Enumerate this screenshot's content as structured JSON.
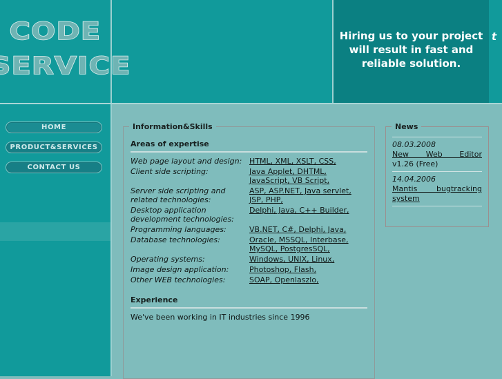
{
  "header": {
    "logo_line1": "CODE",
    "logo_line2": "SERVICE",
    "slogan": "Hiring us to your project will result in fast and reliable solution.",
    "slogan_next_partial": "t"
  },
  "sidebar": {
    "items": [
      {
        "label": "HOME"
      },
      {
        "label": "PRODUCT&SERVICES"
      },
      {
        "label": "CONTACT US"
      }
    ]
  },
  "info_panel": {
    "legend": "Information&Skills",
    "areas_title": "Areas of expertise",
    "skills": [
      {
        "label": "Web page layout and design:",
        "value": "HTML, XML, XSLT, CSS,"
      },
      {
        "label": "Client side scripting:",
        "value": "Java Applet, DHTML, JavaScript, VB Script,"
      },
      {
        "label": "Server side scripting and related technologies:",
        "value": "ASP, ASP.NET, Java servlet, JSP, PHP,"
      },
      {
        "label": "Desktop application development technologies:",
        "value": "Delphi, Java, C++ Builder,"
      },
      {
        "label": "Programming languages:",
        "value": "VB.NET, C#, Delphi, Java,"
      },
      {
        "label": "Database technologies:",
        "value": "Oracle, MSSQL, Interbase, MySQL, PostgresSQL,"
      },
      {
        "label": "Operating systems:",
        "value": "Windows, UNIX, Linux,"
      },
      {
        "label": "Image design application:",
        "value": "Photoshop, Flash,"
      },
      {
        "label": "Other WEB technologies:",
        "value": "SOAP, Openlaszlo,"
      }
    ],
    "experience_title": "Experience",
    "experience_text": "We've been working in IT industries since 1996"
  },
  "news_panel": {
    "legend": "News",
    "entries": [
      {
        "date": "08.03.2008",
        "link": "New Web Editor",
        "sub": "v1.26 (Free)"
      },
      {
        "date": "14.04.2006",
        "link": "Mantis bugtracking system",
        "sub": ""
      }
    ]
  },
  "colors": {
    "header_teal": "#119a9b",
    "slogan_panel": "#0b8082",
    "body_teal": "#7fbcbc",
    "nav_button": "#177f86",
    "divider_light": "#9dd0d0"
  }
}
